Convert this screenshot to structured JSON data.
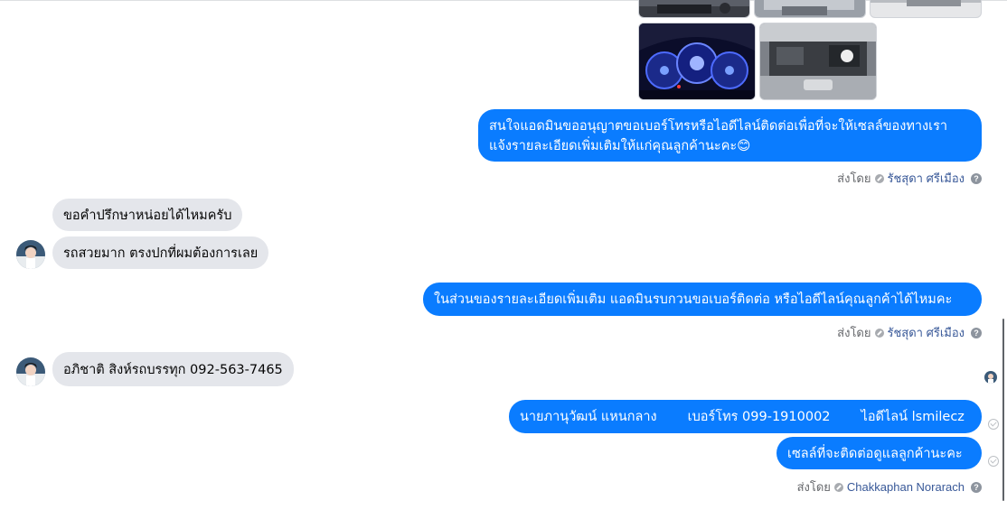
{
  "colors": {
    "outgoing_bubble": "#0a7cff",
    "incoming_bubble": "#e4e6eb",
    "sender_name": "#385898",
    "meta_text": "#65676b"
  },
  "sent_by_label": "ส่งโดย",
  "images": [
    "car-photo",
    "car-photo",
    "car-photo",
    "dashboard-photo",
    "engine-bay-photo"
  ],
  "messages": {
    "m1": {
      "line1": "สนใจแอดมินขออนุญาตขอเบอร์โทรหรือไอดีไลน์ติดต่อเพื่อที่จะให้เซลล์ของทางเรา",
      "line2": "แจ้งรายละเอียดเพิ่มเติมให้แก่คุณลูกค้านะคะ",
      "emoji": "😊",
      "sender": "รัชสุดา ศรีเมือง"
    },
    "m2": "ขอคำปรึกษาหน่อยได้ไหมครับ",
    "m3": "รถสวยมาก ตรงปกที่ผมต้องการเลย",
    "m4": {
      "text": "ในส่วนของรายละเอียดเพิ่มเติม แอดมินรบกวนขอเบอร์ติดต่อ หรือไอดีไลน์คุณลูกค้าได้ไหมคะ",
      "sender": "รัชสุดา ศรีเมือง"
    },
    "m5": "อภิชาติ สิงห์รถบรรทุก 092-563-7465",
    "m6": {
      "name": "นายภานุวัฒน์ แหนกลาง",
      "phone": "เบอร์โทร 099-1910002",
      "line": "ไอดีไลน์ lsmilecz"
    },
    "m7": {
      "text": "เซลล์ที่จะติดต่อดูแลลูกค้านะคะ",
      "sender": "Chakkaphan Norarach"
    }
  }
}
